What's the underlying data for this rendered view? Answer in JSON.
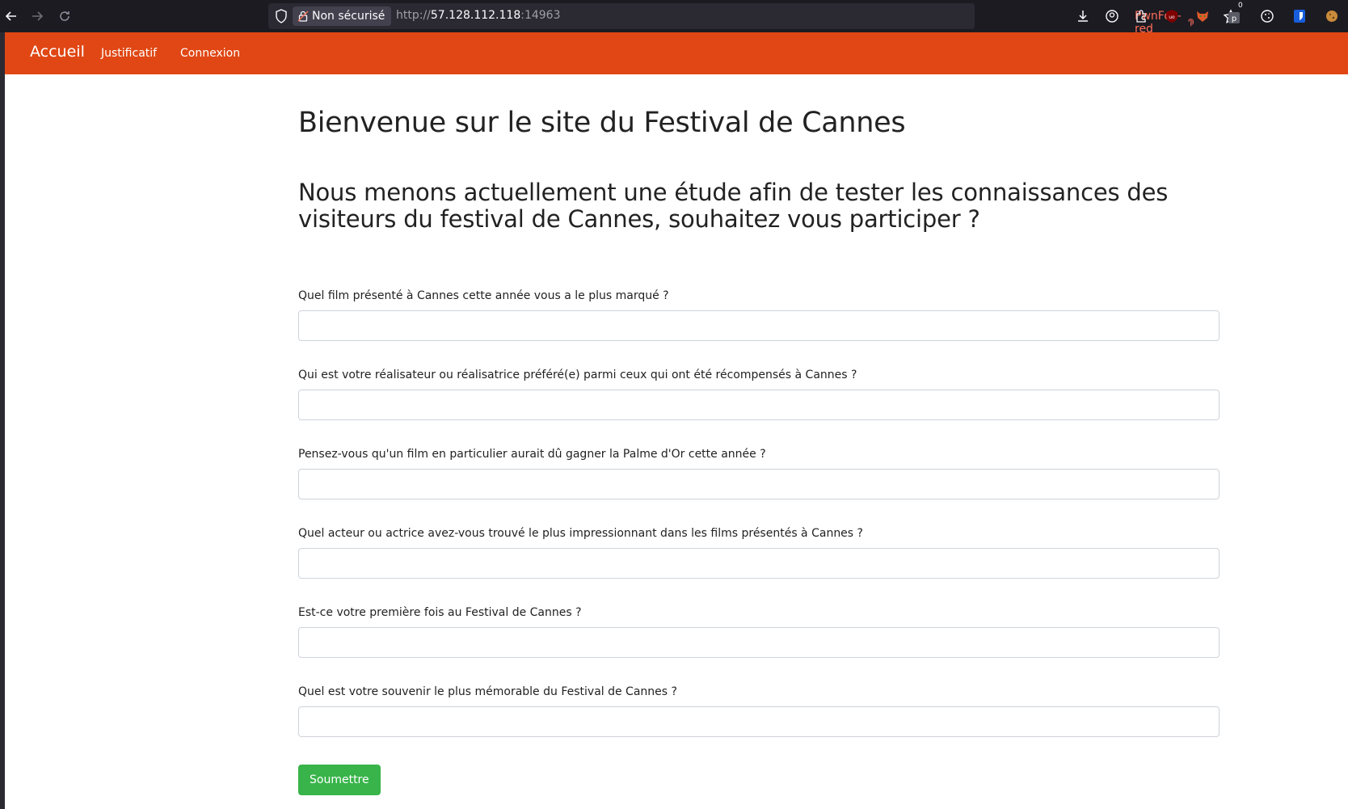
{
  "browser": {
    "back_icon": "arrow-left-icon",
    "forward_icon": "arrow-right-icon",
    "reload_icon": "reload-icon",
    "security_label": "Non sécurisé",
    "url_prefix": "http://",
    "url_host": "57.128.112.118",
    "url_port": ":14963",
    "container_label": "PwnFox-red",
    "toolbar_badge": "0"
  },
  "navbar": {
    "brand": "Accueil",
    "links": [
      "Justificatif",
      "Connexion"
    ],
    "color": "#e04714"
  },
  "page": {
    "title": "Bienvenue sur le site du Festival de Cannes",
    "subtitle": "Nous menons actuellement une étude afin de tester les connaissances des visiteurs du festival de Cannes, souhaitez vous participer ?",
    "questions": [
      {
        "label": "Quel film présenté à Cannes cette année vous a le plus marqué ?",
        "value": ""
      },
      {
        "label": "Qui est votre réalisateur ou réalisatrice préféré(e) parmi ceux qui ont été récompensés à Cannes ?",
        "value": ""
      },
      {
        "label": "Pensez-vous qu'un film en particulier aurait dû gagner la Palme d'Or cette année ?",
        "value": ""
      },
      {
        "label": "Quel acteur ou actrice avez-vous trouvé le plus impressionnant dans les films présentés à Cannes ?",
        "value": ""
      },
      {
        "label": "Est-ce votre première fois au Festival de Cannes ?",
        "value": ""
      },
      {
        "label": "Quel est votre souvenir le plus mémorable du Festival de Cannes ?",
        "value": ""
      }
    ],
    "submit_label": "Soumettre",
    "submit_color": "#38b44a"
  }
}
